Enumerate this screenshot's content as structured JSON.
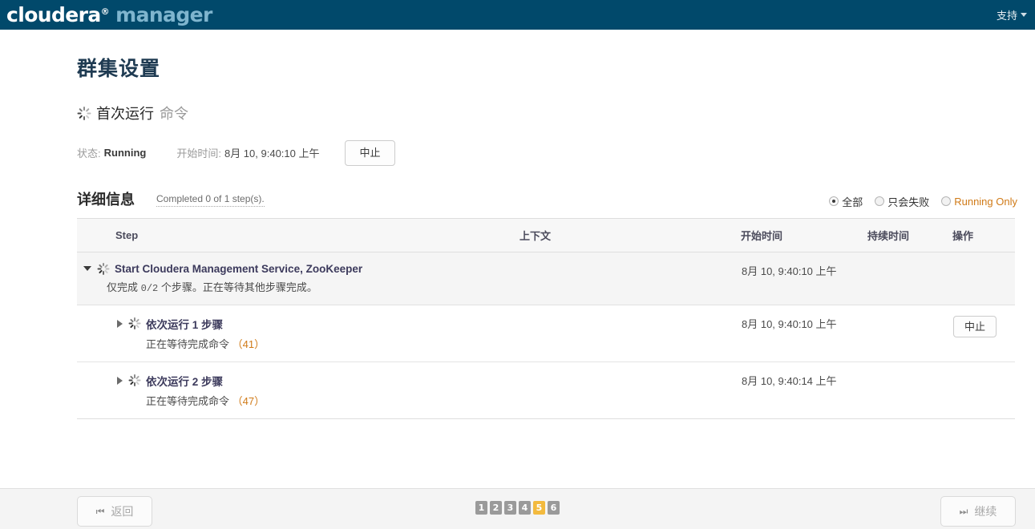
{
  "header": {
    "logo_primary": "cloudera",
    "logo_reg": "®",
    "logo_secondary": "manager",
    "support_label": "支持"
  },
  "page": {
    "title": "群集设置",
    "command_name": "首次运行",
    "command_suffix": "命令",
    "status_label": "状态:",
    "status_value": "Running",
    "start_label": "开始时间:",
    "start_value": "8月 10, 9:40:10 上午",
    "abort_label": "中止"
  },
  "details": {
    "title": "详细信息",
    "completed_note": "Completed 0 of 1 step(s).",
    "filters": [
      {
        "label": "全部",
        "selected": true,
        "accent": false
      },
      {
        "label": "只会失败",
        "selected": false,
        "accent": false
      },
      {
        "label": "Running Only",
        "selected": false,
        "accent": true
      }
    ]
  },
  "table": {
    "columns": [
      "Step",
      "上下文",
      "开始时间",
      "持续时间",
      "操作"
    ],
    "rows": [
      {
        "expanded": true,
        "title": "Start Cloudera Management Service, ZooKeeper",
        "sub_prefix": "仅完成",
        "sub_count": "0/2",
        "sub_suffix": "个步骤。正在等待其他步骤完成。",
        "context": "",
        "start_time": "8月 10, 9:40:10 上午",
        "duration": "",
        "action": ""
      },
      {
        "expanded": false,
        "title": "依次运行 1 步骤",
        "sub_prefix": "正在等待完成命令",
        "sub_count": "",
        "sub_link": "（41）",
        "sub_suffix": "",
        "context": "",
        "start_time": "8月 10, 9:40:10 上午",
        "duration": "",
        "action": "中止"
      },
      {
        "expanded": false,
        "title": "依次运行 2 步骤",
        "sub_prefix": "正在等待完成命令",
        "sub_count": "",
        "sub_link": "（47）",
        "sub_suffix": "",
        "context": "",
        "start_time": "8月 10, 9:40:14 上午",
        "duration": "",
        "action": ""
      }
    ]
  },
  "footer": {
    "back_label": "返回",
    "back_glyph": "⏮",
    "next_label": "继续",
    "next_glyph": "⏭",
    "pages": [
      "1",
      "2",
      "3",
      "4",
      "5",
      "6"
    ],
    "active_page": "5"
  },
  "colors": {
    "header_bg": "#01496b",
    "logo_accent": "#7fb5ce",
    "link_accent": "#d07a17",
    "pager_active": "#f3ba3e"
  }
}
